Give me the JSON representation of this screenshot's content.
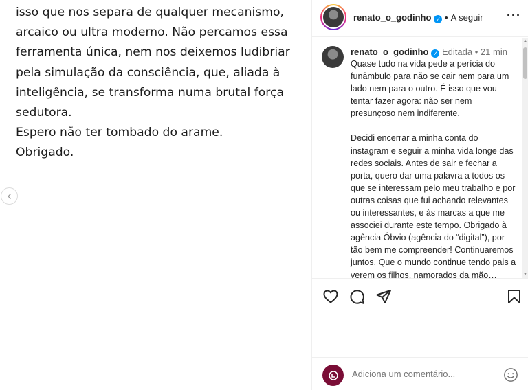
{
  "media": {
    "lines": [
      "isso que nos separa de qualquer mecanismo,",
      "arcaico ou ultra moderno. Não percamos essa",
      "ferramenta única, nem nos deixemos ludibriar",
      "pela simulação da consciência, que, aliada à",
      "inteligência, se transforma numa brutal força",
      "sedutora.",
      "Espero não ter tombado do arame.",
      "Obrigado."
    ],
    "prev_icon": "chevron-left-icon"
  },
  "header": {
    "username": "renato_o_godinho",
    "separator": "•",
    "follow_label": "A seguir",
    "more_label": "···"
  },
  "caption": {
    "username": "renato_o_godinho",
    "edited": "Editada",
    "separator": "•",
    "time": "21 min",
    "paragraph1": "Quase tudo na vida pede a perícia do funâmbulo para não se cair nem para um lado nem para o outro. É isso que vou tentar fazer agora: não ser nem presunçoso nem indiferente.",
    "paragraph2": "Decidi encerrar a minha conta do instagram e seguir a minha vida longe das redes sociais. Antes de sair e fechar a porta, quero dar uma palavra a todos os que se interessam pelo meu trabalho e por outras coisas que fui achando relevantes ou interessantes, e às marcas a que me associei durante este tempo. Obrigado à agência Óbvio (agência do “digital”), por tão bem me compreender! Continuaremos juntos. Que o mundo continue tendo pais a verem os filhos, namorados da mão…"
  },
  "actions": {
    "icons": [
      "heart-icon",
      "comment-icon",
      "share-icon",
      "bookmark-icon"
    ]
  },
  "comment": {
    "placeholder": "Adiciona um comentário..."
  },
  "colors": {
    "verified": "#0095f6",
    "text": "#262626",
    "muted": "#737373",
    "comment_avatar": "#7a0d36"
  }
}
